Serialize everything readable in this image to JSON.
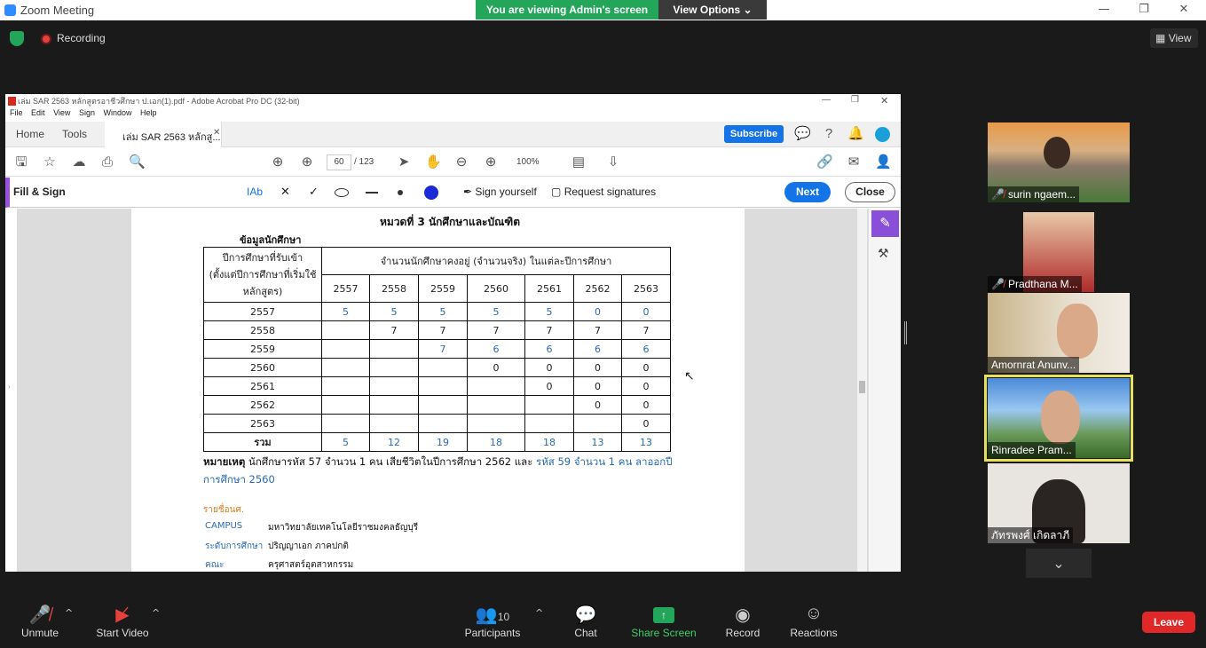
{
  "zoom": {
    "title": "Zoom Meeting",
    "viewing_banner": "You are viewing Admin's screen",
    "view_options": "View Options",
    "recording": "Recording",
    "view": "View",
    "minimize": "—",
    "maximize": "❐",
    "close": "✕"
  },
  "acrobat": {
    "title": "เล่ม SAR 2563 หลักสูตรอาชีวศึกษา ป.เอก(1).pdf - Adobe Acrobat Pro DC (32-bit)",
    "menu": [
      "File",
      "Edit",
      "View",
      "Sign",
      "Window",
      "Help"
    ],
    "tabs": {
      "home": "Home",
      "tools": "Tools",
      "doc": "เล่ม SAR 2563 หลักสู..."
    },
    "subscribe": "Subscribe",
    "page_current": "60",
    "page_total": "/ 123",
    "zoom_level": "100%",
    "fill_sign": {
      "title": "Fill & Sign",
      "sign_yourself": "Sign yourself",
      "request_signatures": "Request signatures",
      "next": "Next",
      "close": "Close",
      "text_tool": "IAb"
    }
  },
  "document": {
    "chapter_title": "หมวดที่ 3 นักศึกษาและบัณฑิต",
    "section_title": "ข้อมูลนักศึกษา",
    "header_left": [
      "ปีการศึกษาที่รับเข้า",
      "(ตั้งแต่ปีการศึกษาที่เริ่มใช้",
      "หลักสูตร)"
    ],
    "header_span": "จำนวนนักศึกษาคงอยู่ (จำนวนจริง) ในแต่ละปีการศึกษา",
    "years": [
      "2557",
      "2558",
      "2559",
      "2560",
      "2561",
      "2562",
      "2563"
    ],
    "rows": [
      {
        "year": "2557",
        "cells": [
          "5",
          "5",
          "5",
          "5",
          "5",
          "0",
          "0"
        ]
      },
      {
        "year": "2558",
        "cells": [
          "",
          "7",
          "7",
          "7",
          "7",
          "7",
          "7"
        ]
      },
      {
        "year": "2559",
        "cells": [
          "",
          "",
          "7",
          "6",
          "6",
          "6",
          "6"
        ]
      },
      {
        "year": "2560",
        "cells": [
          "",
          "",
          "",
          "0",
          "0",
          "0",
          "0"
        ]
      },
      {
        "year": "2561",
        "cells": [
          "",
          "",
          "",
          "",
          "0",
          "0",
          "0"
        ]
      },
      {
        "year": "2562",
        "cells": [
          "",
          "",
          "",
          "",
          "",
          "0",
          "0"
        ]
      },
      {
        "year": "2563",
        "cells": [
          "",
          "",
          "",
          "",
          "",
          "",
          "0"
        ]
      }
    ],
    "total_label": "รวม",
    "totals": [
      "5",
      "12",
      "19",
      "18",
      "18",
      "13",
      "13"
    ],
    "note_label": "หมายเหตุ",
    "note_text_black": "นักศึกษารหัส 57 จำนวน 1 คน เสียชีวิตในปีการศึกษา 2562 และ",
    "note_text_blue": "รหัส 59 จำนวน 1 คน ลาออกปี",
    "note_line2": "การศึกษา 2560",
    "sub_heading": "รายชื่อนศ.",
    "info": [
      {
        "label": "CAMPUS",
        "value": "มหาวิทยาลัยเทคโนโลยีราชมงคลธัญบุรี"
      },
      {
        "label": "ระดับการศึกษา",
        "value": "ปริญญาเอก ภาคปกติ"
      },
      {
        "label": "คณะ",
        "value": "ครุศาสตร์อุตสาหกรรม"
      }
    ]
  },
  "participants": [
    {
      "name": "surin ngaem...",
      "muted": true
    },
    {
      "name": "Pradthana M...",
      "muted": true
    },
    {
      "name": "Amornrat Anunv...",
      "muted": false
    },
    {
      "name": "Rinradee Pram...",
      "muted": false
    },
    {
      "name": "ภัทรพงศ์ เกิดลาภี",
      "muted": false
    }
  ],
  "toolbar": {
    "unmute": "Unmute",
    "start_video": "Start Video",
    "participants": "Participants",
    "participants_count": "10",
    "chat": "Chat",
    "share_screen": "Share Screen",
    "record": "Record",
    "reactions": "Reactions",
    "leave": "Leave"
  },
  "colors": {
    "share_green": "#23a55a",
    "acrobat_blue": "#1473e6",
    "leave_red": "#e02828",
    "doc_blue": "#2a6bb0",
    "active_speaker": "#e6e05a"
  }
}
